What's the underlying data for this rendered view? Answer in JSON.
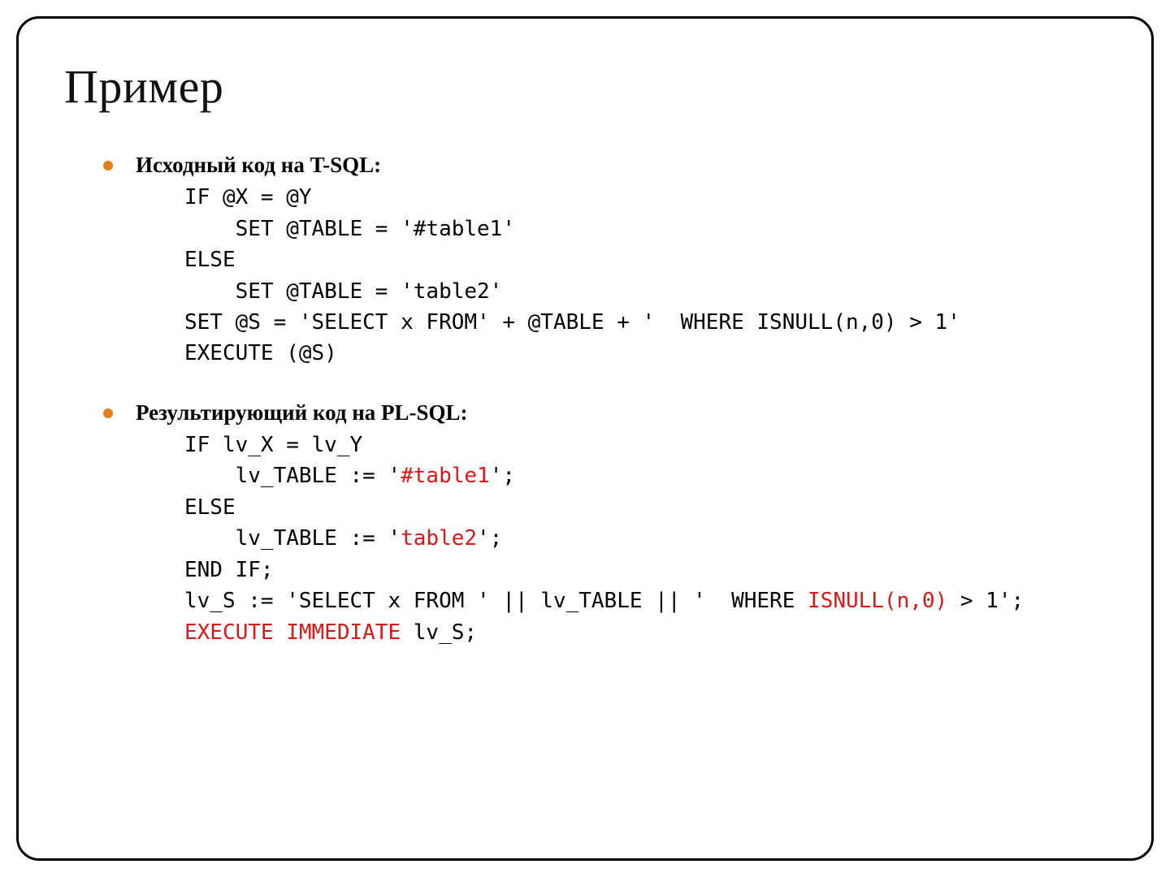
{
  "title": "Пример",
  "sections": [
    {
      "heading": "Исходный код на T-SQL:",
      "code_plain": "IF @X = @Y\n    SET @TABLE = '#table1'\nELSE\n    SET @TABLE = 'table2'\nSET @S = 'SELECT x FROM' + @TABLE + '  WHERE ISNULL(n,0) > 1'\nEXECUTE (@S)"
    },
    {
      "heading": "Результирующий код на PL-SQL:",
      "code_tokens": [
        {
          "t": "IF lv_X = lv_Y\n    lv_TABLE := '"
        },
        {
          "t": "#table1",
          "hl": true
        },
        {
          "t": "';\nELSE\n    lv_TABLE := '"
        },
        {
          "t": "table2",
          "hl": true
        },
        {
          "t": "';\nEND IF;\nlv_S := 'SELECT x FROM ' || lv_TABLE || '  WHERE "
        },
        {
          "t": "ISNULL(n,0)",
          "hl": true
        },
        {
          "t": " > 1';\n"
        },
        {
          "t": "EXECUTE IMMEDIATE",
          "hl": true
        },
        {
          "t": " lv_S;"
        }
      ]
    }
  ]
}
